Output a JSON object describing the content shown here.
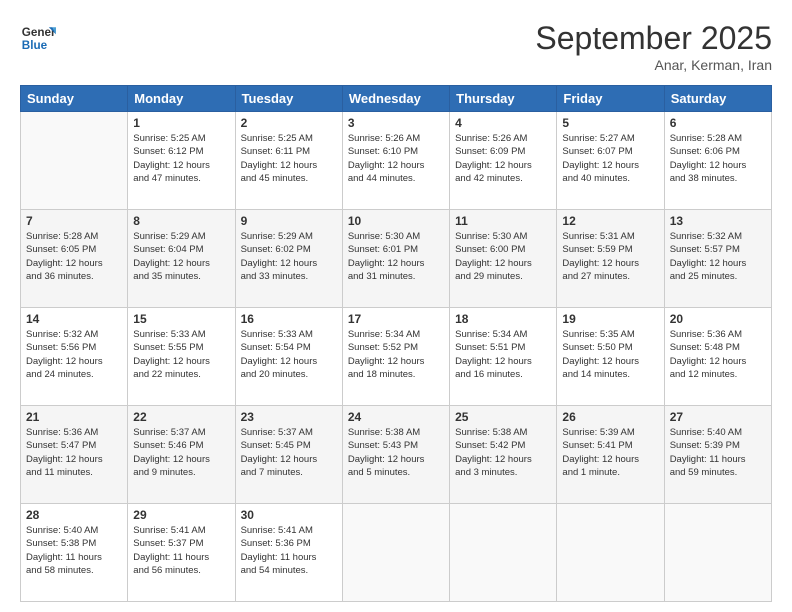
{
  "logo": {
    "line1": "General",
    "line2": "Blue"
  },
  "header": {
    "month": "September 2025",
    "location": "Anar, Kerman, Iran"
  },
  "weekdays": [
    "Sunday",
    "Monday",
    "Tuesday",
    "Wednesday",
    "Thursday",
    "Friday",
    "Saturday"
  ],
  "weeks": [
    [
      {
        "day": "",
        "info": ""
      },
      {
        "day": "1",
        "info": "Sunrise: 5:25 AM\nSunset: 6:12 PM\nDaylight: 12 hours\nand 47 minutes."
      },
      {
        "day": "2",
        "info": "Sunrise: 5:25 AM\nSunset: 6:11 PM\nDaylight: 12 hours\nand 45 minutes."
      },
      {
        "day": "3",
        "info": "Sunrise: 5:26 AM\nSunset: 6:10 PM\nDaylight: 12 hours\nand 44 minutes."
      },
      {
        "day": "4",
        "info": "Sunrise: 5:26 AM\nSunset: 6:09 PM\nDaylight: 12 hours\nand 42 minutes."
      },
      {
        "day": "5",
        "info": "Sunrise: 5:27 AM\nSunset: 6:07 PM\nDaylight: 12 hours\nand 40 minutes."
      },
      {
        "day": "6",
        "info": "Sunrise: 5:28 AM\nSunset: 6:06 PM\nDaylight: 12 hours\nand 38 minutes."
      }
    ],
    [
      {
        "day": "7",
        "info": "Sunrise: 5:28 AM\nSunset: 6:05 PM\nDaylight: 12 hours\nand 36 minutes."
      },
      {
        "day": "8",
        "info": "Sunrise: 5:29 AM\nSunset: 6:04 PM\nDaylight: 12 hours\nand 35 minutes."
      },
      {
        "day": "9",
        "info": "Sunrise: 5:29 AM\nSunset: 6:02 PM\nDaylight: 12 hours\nand 33 minutes."
      },
      {
        "day": "10",
        "info": "Sunrise: 5:30 AM\nSunset: 6:01 PM\nDaylight: 12 hours\nand 31 minutes."
      },
      {
        "day": "11",
        "info": "Sunrise: 5:30 AM\nSunset: 6:00 PM\nDaylight: 12 hours\nand 29 minutes."
      },
      {
        "day": "12",
        "info": "Sunrise: 5:31 AM\nSunset: 5:59 PM\nDaylight: 12 hours\nand 27 minutes."
      },
      {
        "day": "13",
        "info": "Sunrise: 5:32 AM\nSunset: 5:57 PM\nDaylight: 12 hours\nand 25 minutes."
      }
    ],
    [
      {
        "day": "14",
        "info": "Sunrise: 5:32 AM\nSunset: 5:56 PM\nDaylight: 12 hours\nand 24 minutes."
      },
      {
        "day": "15",
        "info": "Sunrise: 5:33 AM\nSunset: 5:55 PM\nDaylight: 12 hours\nand 22 minutes."
      },
      {
        "day": "16",
        "info": "Sunrise: 5:33 AM\nSunset: 5:54 PM\nDaylight: 12 hours\nand 20 minutes."
      },
      {
        "day": "17",
        "info": "Sunrise: 5:34 AM\nSunset: 5:52 PM\nDaylight: 12 hours\nand 18 minutes."
      },
      {
        "day": "18",
        "info": "Sunrise: 5:34 AM\nSunset: 5:51 PM\nDaylight: 12 hours\nand 16 minutes."
      },
      {
        "day": "19",
        "info": "Sunrise: 5:35 AM\nSunset: 5:50 PM\nDaylight: 12 hours\nand 14 minutes."
      },
      {
        "day": "20",
        "info": "Sunrise: 5:36 AM\nSunset: 5:48 PM\nDaylight: 12 hours\nand 12 minutes."
      }
    ],
    [
      {
        "day": "21",
        "info": "Sunrise: 5:36 AM\nSunset: 5:47 PM\nDaylight: 12 hours\nand 11 minutes."
      },
      {
        "day": "22",
        "info": "Sunrise: 5:37 AM\nSunset: 5:46 PM\nDaylight: 12 hours\nand 9 minutes."
      },
      {
        "day": "23",
        "info": "Sunrise: 5:37 AM\nSunset: 5:45 PM\nDaylight: 12 hours\nand 7 minutes."
      },
      {
        "day": "24",
        "info": "Sunrise: 5:38 AM\nSunset: 5:43 PM\nDaylight: 12 hours\nand 5 minutes."
      },
      {
        "day": "25",
        "info": "Sunrise: 5:38 AM\nSunset: 5:42 PM\nDaylight: 12 hours\nand 3 minutes."
      },
      {
        "day": "26",
        "info": "Sunrise: 5:39 AM\nSunset: 5:41 PM\nDaylight: 12 hours\nand 1 minute."
      },
      {
        "day": "27",
        "info": "Sunrise: 5:40 AM\nSunset: 5:39 PM\nDaylight: 11 hours\nand 59 minutes."
      }
    ],
    [
      {
        "day": "28",
        "info": "Sunrise: 5:40 AM\nSunset: 5:38 PM\nDaylight: 11 hours\nand 58 minutes."
      },
      {
        "day": "29",
        "info": "Sunrise: 5:41 AM\nSunset: 5:37 PM\nDaylight: 11 hours\nand 56 minutes."
      },
      {
        "day": "30",
        "info": "Sunrise: 5:41 AM\nSunset: 5:36 PM\nDaylight: 11 hours\nand 54 minutes."
      },
      {
        "day": "",
        "info": ""
      },
      {
        "day": "",
        "info": ""
      },
      {
        "day": "",
        "info": ""
      },
      {
        "day": "",
        "info": ""
      }
    ]
  ]
}
